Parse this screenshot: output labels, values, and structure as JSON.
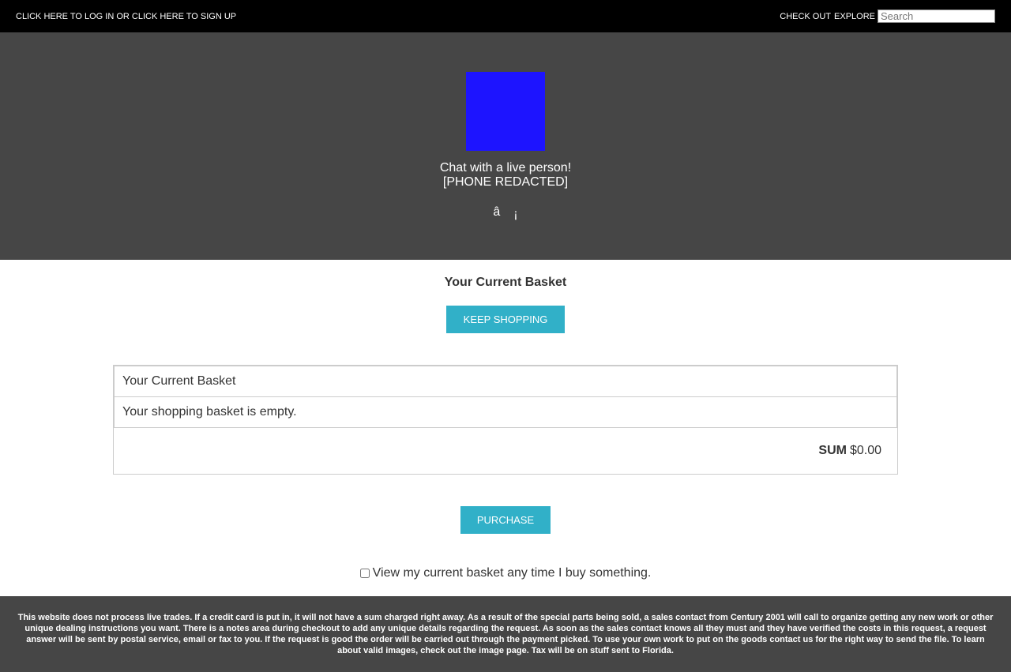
{
  "topbar": {
    "auth_text": "CLICK HERE TO LOG IN OR CLICK HERE TO SIGN UP",
    "checkout_label": "CHECK OUT",
    "explore_label": "EXPLORE",
    "search_placeholder": "Search"
  },
  "hero": {
    "chat_line": "Chat with a live person!",
    "phone": "[PHONE REDACTED]",
    "icon_a": "â",
    "icon_b": "¡"
  },
  "basket": {
    "title": "Your Current Basket",
    "keep_shopping": "KEEP SHOPPING",
    "table_header": "Your Current Basket",
    "empty_message": "Your shopping basket is empty.",
    "sum_label": "SUM",
    "sum_value": "$0.00",
    "purchase": "PURCHASE",
    "remember_label": "View my current basket any time I buy something."
  },
  "footer": {
    "text": "This website does not process live trades. If a credit card is put in, it will not have a sum charged right away. As a result of the special parts being sold, a sales contact from Century 2001 will call to organize getting any new work or other unique dealing instructions you want. There is a notes area during checkout to add any unique details regarding the request. As soon as the sales contact knows all they must and they have verified the costs in this request, a request answer will be sent by postal service, email or fax to you. If the request is good the order will be carried out through the payment picked. To use your own work to put on the goods contact us for the right way to send the file. To learn about valid images, check out the image page. Tax will be on stuff sent to Florida."
  },
  "colors": {
    "topbar_bg": "#000000",
    "hero_bg": "#464646",
    "logo": "#1d14ff",
    "button": "#31b0c8"
  }
}
